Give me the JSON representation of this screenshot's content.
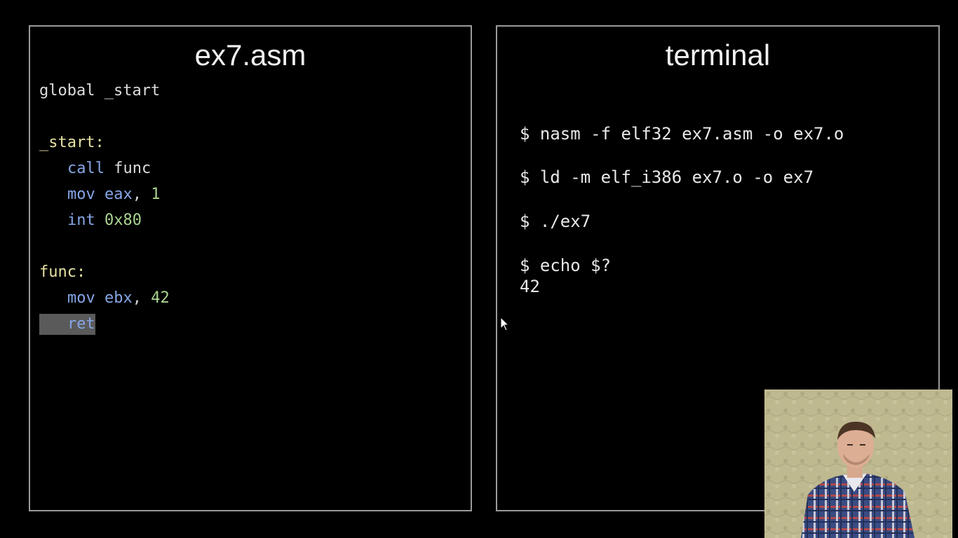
{
  "editor": {
    "title": "ex7.asm",
    "lines": [
      {
        "text": "global _start"
      },
      {
        "label": "_start:"
      },
      {
        "mnemonic": "call",
        "operand": "func"
      },
      {
        "mnemonic": "mov",
        "register": "eax",
        "separator": ",",
        "value": "1"
      },
      {
        "mnemonic": "int",
        "value": "0x80"
      },
      {
        "label": "func:"
      },
      {
        "mnemonic": "mov",
        "register": "ebx",
        "separator": ",",
        "value": "42"
      },
      {
        "mnemonic": "ret",
        "selected": true
      }
    ]
  },
  "terminal": {
    "title": "terminal",
    "commands": [
      "$ nasm -f elf32 ex7.asm -o ex7.o",
      "$ ld -m elf_i386 ex7.o -o ex7",
      "$ ./ex7",
      "$ echo $?"
    ],
    "output": "42"
  },
  "colors": {
    "background": "#000000",
    "panel_border": "#9a9a9a",
    "label": "#e6e1a3",
    "mnemonic": "#86a6e6",
    "number": "#a9d48f",
    "selection": "#5a5a5a"
  },
  "icons": [
    "mouse-pointer-icon"
  ]
}
